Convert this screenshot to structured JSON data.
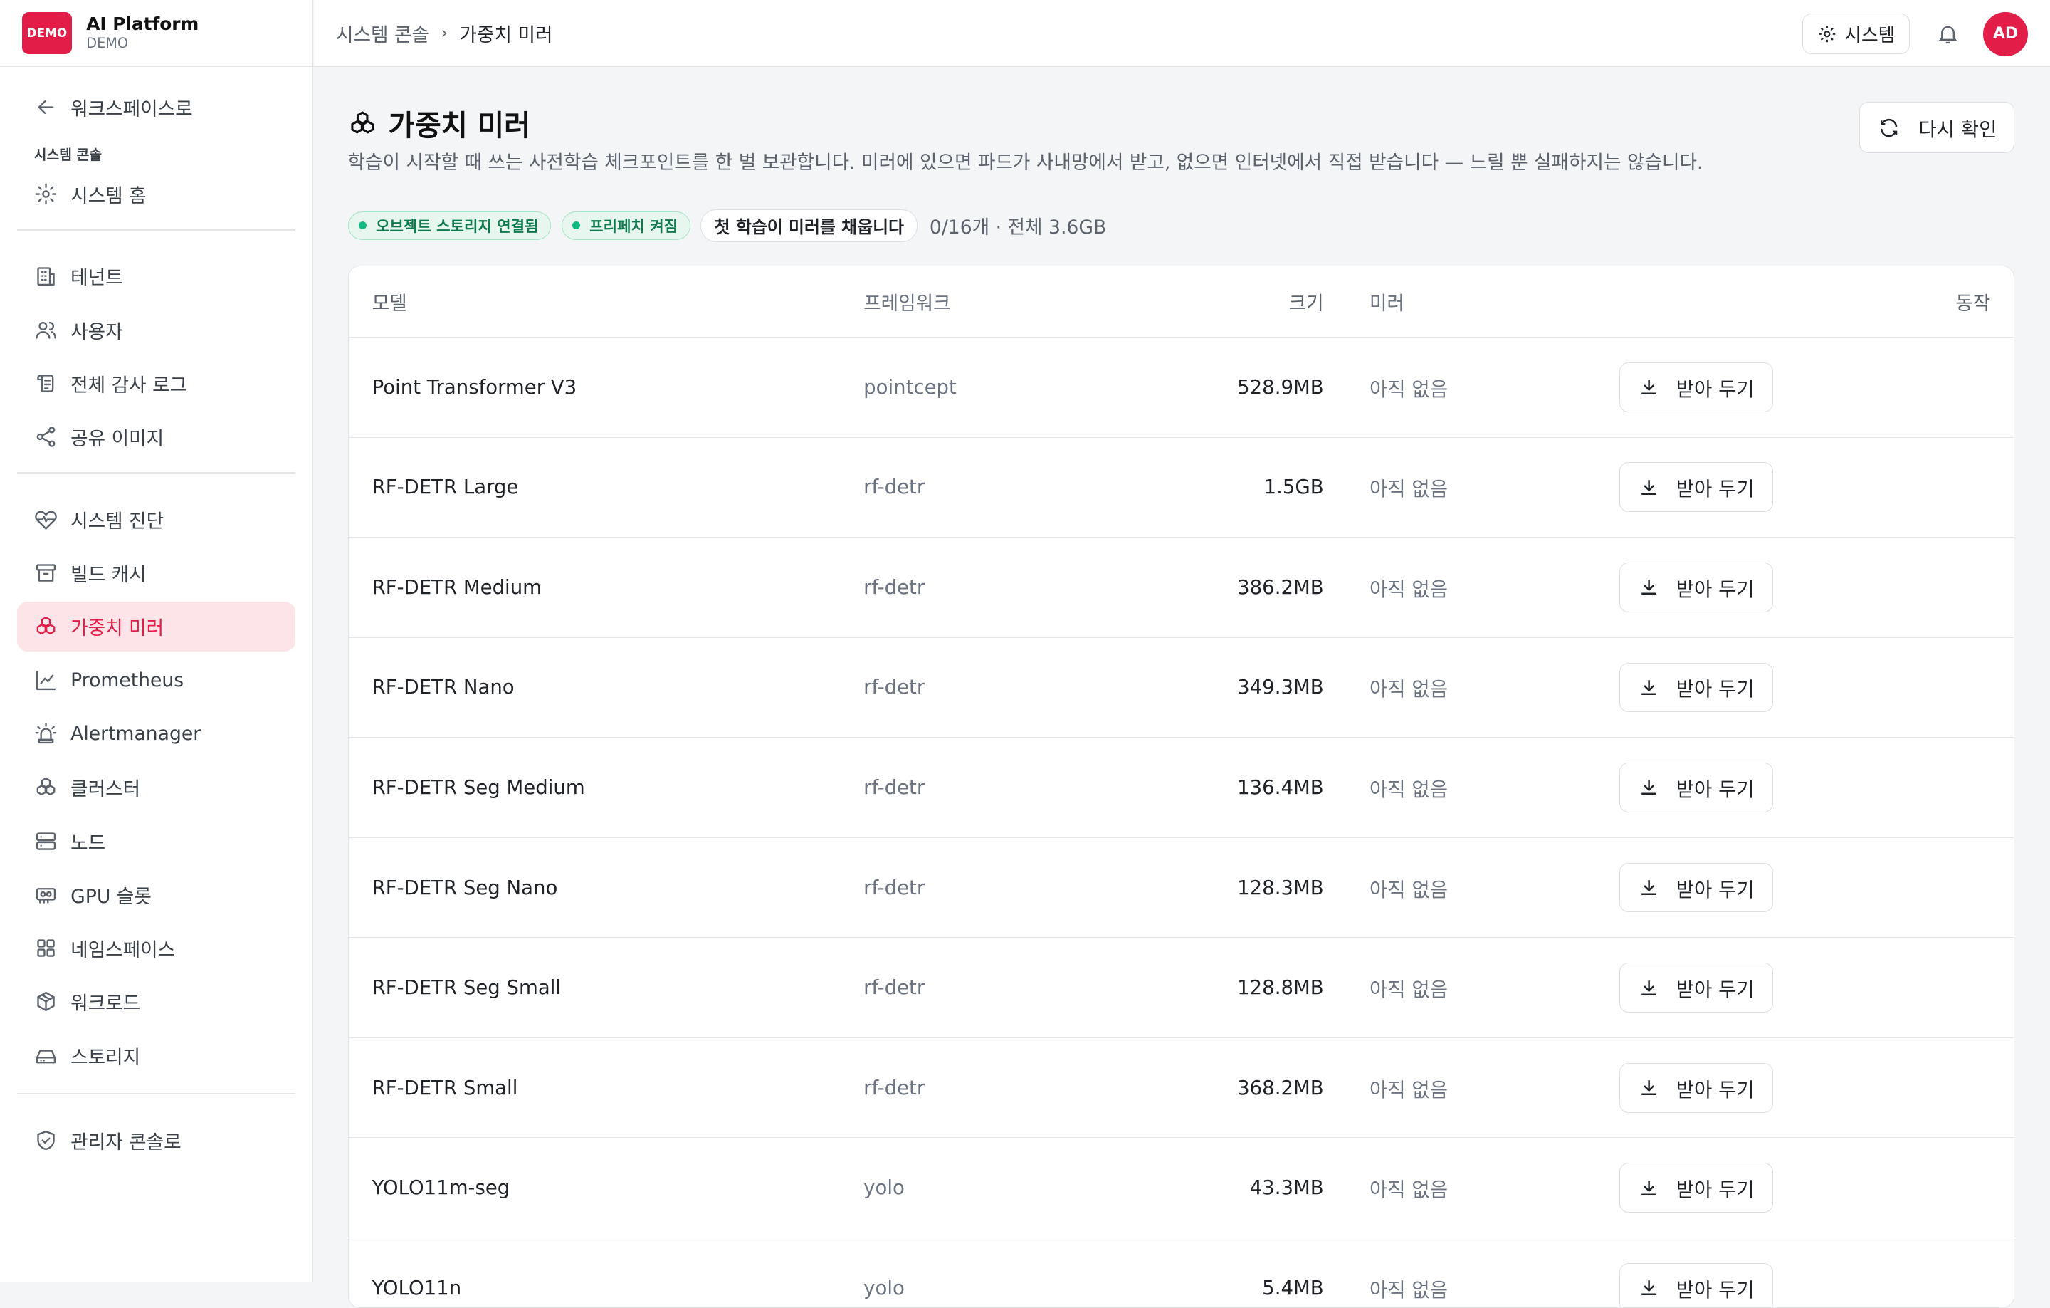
{
  "brand": {
    "logo": "DEMO",
    "name": "AI Platform",
    "sub": "DEMO"
  },
  "sidebar": {
    "back": "워크스페이스로",
    "section": "시스템 콘솔",
    "home": "시스템 홈",
    "group1": [
      "테넌트",
      "사용자",
      "전체 감사 로그",
      "공유 이미지"
    ],
    "group2": [
      "시스템 진단",
      "빌드 캐시",
      "가중치 미러",
      "Prometheus",
      "Alertmanager",
      "클러스터",
      "노드",
      "GPU 슬롯",
      "네임스페이스",
      "워크로드",
      "스토리지"
    ],
    "admin": "관리자 콘솔로"
  },
  "topbar": {
    "crumb_parent": "시스템 콘솔",
    "crumb_sep": "›",
    "crumb_current": "가중치 미러",
    "system_label": "시스템",
    "avatar": "AD"
  },
  "page": {
    "title": "가중치 미러",
    "description": "학습이 시작할 때 쓰는 사전학습 체크포인트를 한 벌 보관합니다. 미러에 있으면 파드가 사내망에서 받고, 없으면 인터넷에서 직접 받습니다 — 느릴 뿐 실패하지는 않습니다.",
    "recheck_label": "다시 확인"
  },
  "status": {
    "storage": "오브젝트 스토리지 연결됨",
    "prefetch": "프리페치 켜짐",
    "first_train": "첫 학습이 미러를 채웁니다",
    "summary": "0/16개 · 전체 3.6GB"
  },
  "table": {
    "headers": {
      "model": "모델",
      "framework": "프레임워크",
      "size": "크기",
      "mirror": "미러",
      "action": "동작"
    },
    "download_label": "받아 두기",
    "rows": [
      {
        "model": "Point Transformer V3",
        "framework": "pointcept",
        "size": "528.9MB",
        "mirror": "아직 없음"
      },
      {
        "model": "RF-DETR Large",
        "framework": "rf-detr",
        "size": "1.5GB",
        "mirror": "아직 없음"
      },
      {
        "model": "RF-DETR Medium",
        "framework": "rf-detr",
        "size": "386.2MB",
        "mirror": "아직 없음"
      },
      {
        "model": "RF-DETR Nano",
        "framework": "rf-detr",
        "size": "349.3MB",
        "mirror": "아직 없음"
      },
      {
        "model": "RF-DETR Seg Medium",
        "framework": "rf-detr",
        "size": "136.4MB",
        "mirror": "아직 없음"
      },
      {
        "model": "RF-DETR Seg Nano",
        "framework": "rf-detr",
        "size": "128.3MB",
        "mirror": "아직 없음"
      },
      {
        "model": "RF-DETR Seg Small",
        "framework": "rf-detr",
        "size": "128.8MB",
        "mirror": "아직 없음"
      },
      {
        "model": "RF-DETR Small",
        "framework": "rf-detr",
        "size": "368.2MB",
        "mirror": "아직 없음"
      },
      {
        "model": "YOLO11m-seg",
        "framework": "yolo",
        "size": "43.3MB",
        "mirror": "아직 없음"
      },
      {
        "model": "YOLO11n",
        "framework": "yolo",
        "size": "5.4MB",
        "mirror": "아직 없음"
      }
    ]
  },
  "colors": {
    "accent": "#e11d48",
    "success": "#10b981"
  }
}
